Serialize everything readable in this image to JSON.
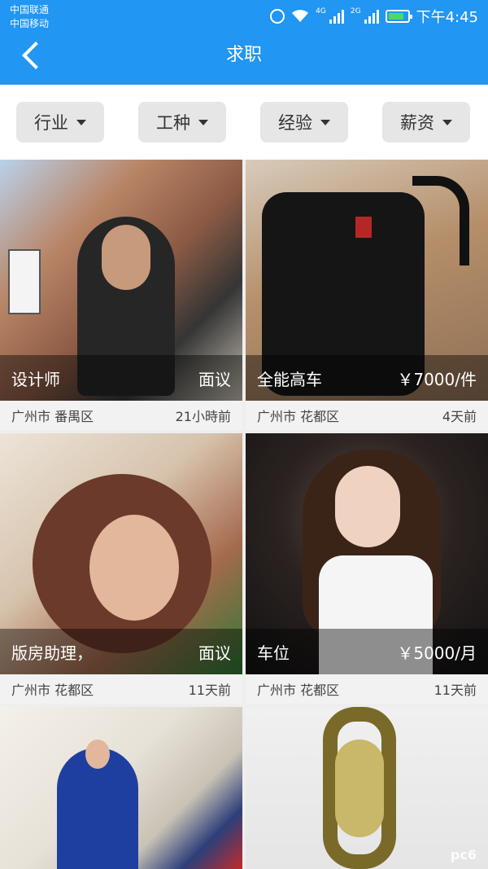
{
  "status_bar": {
    "carrier_1": "中国联通",
    "carrier_2": "中国移动",
    "network_1": "4G",
    "network_2": "2G",
    "time": "下午4:45"
  },
  "header": {
    "title": "求职",
    "back_icon": "chevron-left-icon"
  },
  "filters": [
    {
      "label": "行业"
    },
    {
      "label": "工种"
    },
    {
      "label": "经验"
    },
    {
      "label": "薪资"
    }
  ],
  "listings": [
    {
      "title": "设计师",
      "pay": "面议",
      "location": "广州市  番禺区",
      "time": "21小時前"
    },
    {
      "title": "全能高车",
      "pay": "￥7000/件",
      "location": "广州市  花都区",
      "time": "4天前"
    },
    {
      "title": "版房助理，",
      "pay": "面议",
      "location": "广州市  花都区",
      "time": "11天前"
    },
    {
      "title": "车位",
      "pay": "￥5000/月",
      "location": "广州市  花都区",
      "time": "11天前"
    }
  ],
  "watermark": "pc6",
  "colors": {
    "accent": "#2196f3"
  }
}
